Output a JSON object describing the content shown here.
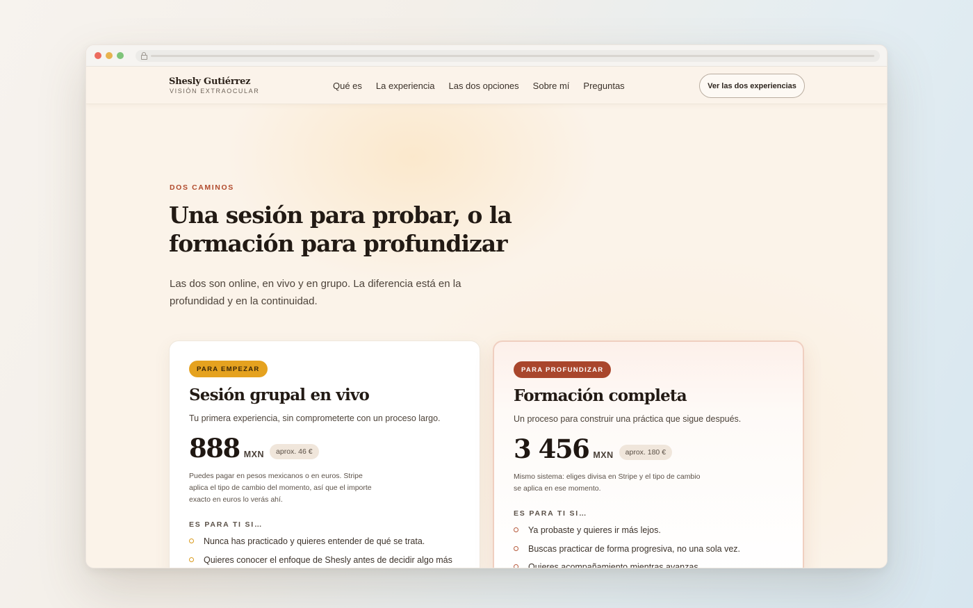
{
  "brand": {
    "name": "Shesly Gutiérrez",
    "tagline": "VISIÓN EXTRAOCULAR"
  },
  "nav": {
    "items": [
      "Qué es",
      "La experiencia",
      "Las dos opciones",
      "Sobre mí",
      "Preguntas"
    ],
    "cta": "Ver las dos experiencias"
  },
  "hero": {
    "eyebrow": "DOS CAMINOS",
    "title": "Una sesión para probar, o la formación para profundizar",
    "subtitle": "Las dos son online, en vivo y en grupo. La diferencia está en la profundidad y en la continuidad."
  },
  "cards": [
    {
      "badge": "PARA EMPEZAR",
      "title": "Sesión grupal en vivo",
      "subtitle": "Tu primera experiencia, sin comprometerte con un proceso largo.",
      "price": "888",
      "currency": "MXN",
      "approx": "aprox. 46 €",
      "note": "Puedes pagar en pesos mexicanos o en euros. Stripe aplica el tipo de cambio del momento, así que el importe exacto en euros lo verás ahí.",
      "fit_label": "ES PARA TI SI…",
      "fit_items": [
        "Nunca has practicado y quieres entender de qué se trata.",
        "Quieres conocer el enfoque de Shesly antes de decidir algo más"
      ],
      "accent": "#e5a21f"
    },
    {
      "badge": "PARA PROFUNDIZAR",
      "title": "Formación completa",
      "subtitle": "Un proceso para construir una práctica que sigue después.",
      "price": "3 456",
      "currency": "MXN",
      "approx": "aprox. 180 €",
      "note": "Mismo sistema: eliges divisa en Stripe y el tipo de cambio se aplica en ese momento.",
      "fit_label": "ES PARA TI SI…",
      "fit_items": [
        "Ya probaste y quieres ir más lejos.",
        "Buscas practicar de forma progresiva, no una sola vez.",
        "Quieres acompañamiento mientras avanzas."
      ],
      "accent": "#a9462c"
    }
  ]
}
